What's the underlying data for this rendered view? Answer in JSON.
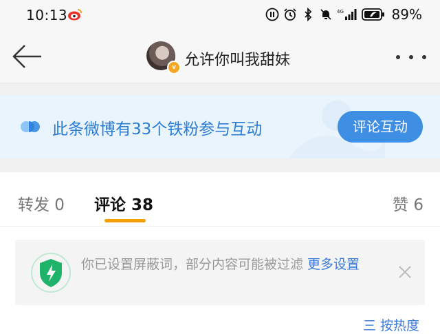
{
  "status_bar": {
    "time": "10:13",
    "battery_percent": "89%",
    "icons": [
      "weibo-icon",
      "sync-icon",
      "alarm-icon",
      "bluetooth-icon",
      "mute-icon",
      "signal-4g-icon",
      "battery-icon"
    ]
  },
  "header": {
    "title": "允许你叫我甜妹",
    "verified_badge": "v"
  },
  "banner": {
    "text": "此条微博有33个铁粉参与互动",
    "button_label": "评论互动"
  },
  "tabs": [
    {
      "label": "转发 0",
      "active": false
    },
    {
      "label": "评论 38",
      "active": true
    },
    {
      "label": "赞 6",
      "active": false
    }
  ],
  "notice": {
    "text": "你已设置屏蔽词，部分内容可能被过滤 ",
    "link_label": "更多设置"
  },
  "sort": {
    "label": "三 按热度"
  },
  "colors": {
    "accent_blue": "#3e8ee3",
    "link_blue": "#3a7bd5",
    "tab_underline": "#f5a000",
    "shield_green": "#1fb36a"
  }
}
